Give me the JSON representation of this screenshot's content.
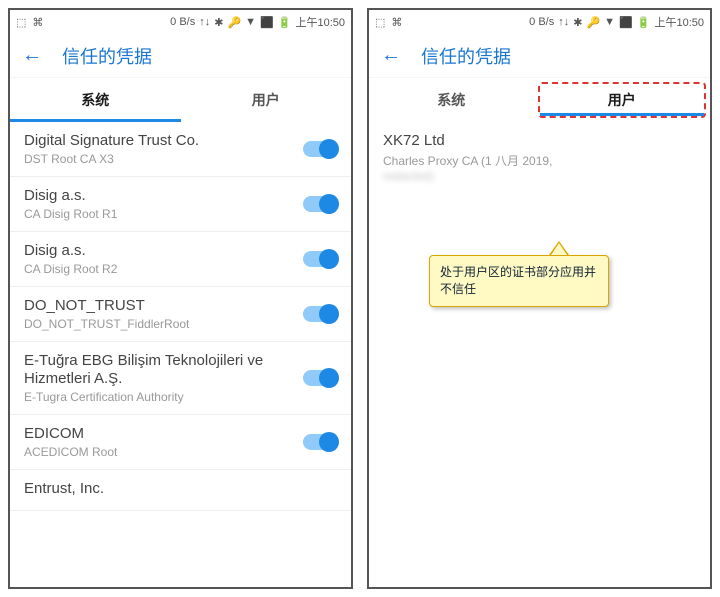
{
  "statusbar": {
    "left_icons": [
      "⬚",
      "⌘"
    ],
    "net_rate": "0 B/s",
    "glyphs": [
      "↑↓",
      "✱",
      "🔑",
      "▼",
      "⬛",
      "🔋"
    ],
    "time": "上午10:50"
  },
  "header": {
    "back": "←",
    "title": "信任的凭据"
  },
  "tabs": {
    "system": "系统",
    "user": "用户"
  },
  "left_phone": {
    "active_tab": "system",
    "certs": [
      {
        "name": "Digital Signature Trust Co.",
        "sub": "DST Root CA X3"
      },
      {
        "name": "Disig a.s.",
        "sub": "CA Disig Root R1"
      },
      {
        "name": "Disig a.s.",
        "sub": "CA Disig Root R2"
      },
      {
        "name": "DO_NOT_TRUST",
        "sub": "DO_NOT_TRUST_FiddlerRoot"
      },
      {
        "name": "E-Tuğra EBG Bilişim Teknolojileri ve Hizmetleri A.Ş.",
        "sub": "E-Tugra Certification Authority"
      },
      {
        "name": "EDICOM",
        "sub": "ACEDICOM Root"
      },
      {
        "name": "Entrust, Inc.",
        "sub": ""
      }
    ]
  },
  "right_phone": {
    "active_tab": "user",
    "certs": [
      {
        "name": "XK72 Ltd",
        "sub": "Charles Proxy CA (1 八月 2019,",
        "sub2_blurred": "redacted)"
      }
    ]
  },
  "callout": {
    "text": "处于用户区的证书部分应用并不信任"
  }
}
